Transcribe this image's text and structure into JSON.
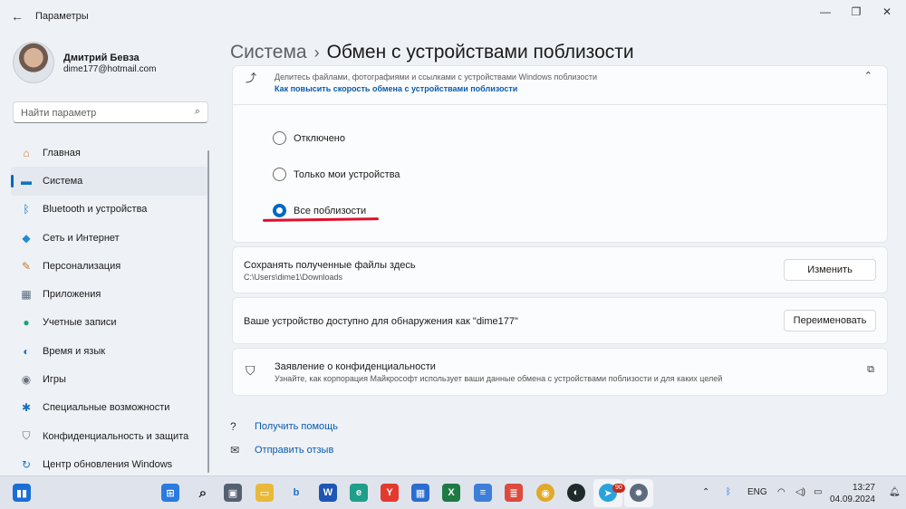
{
  "window": {
    "title": "Параметры",
    "back_icon": "←",
    "minimize": "—",
    "maximize": "❐",
    "close": "✕"
  },
  "profile": {
    "name": "Дмитрий Бевза",
    "email": "dime177@hotmail.com"
  },
  "search": {
    "placeholder": "Найти параметр",
    "icon": "⌕"
  },
  "sidebar": {
    "items": [
      {
        "label": "Главная",
        "icon": "home-icon",
        "glyph": "⌂",
        "color": "#e07a3a"
      },
      {
        "label": "Система",
        "icon": "system-icon",
        "glyph": "▬",
        "color": "#0a74c8"
      },
      {
        "label": "Bluetooth и устройства",
        "icon": "bluetooth-icon",
        "glyph": "ᛒ",
        "color": "#0a74c8"
      },
      {
        "label": "Сеть и Интернет",
        "icon": "wifi-icon",
        "glyph": "◆",
        "color": "#1f8ad6"
      },
      {
        "label": "Персонализация",
        "icon": "brush-icon",
        "glyph": "✎",
        "color": "#c8772c"
      },
      {
        "label": "Приложения",
        "icon": "apps-icon",
        "glyph": "▦",
        "color": "#5a6a80"
      },
      {
        "label": "Учетные записи",
        "icon": "accounts-icon",
        "glyph": "●",
        "color": "#1aa37a"
      },
      {
        "label": "Время и язык",
        "icon": "time-language-icon",
        "glyph": "◐",
        "color": "#1a78c8"
      },
      {
        "label": "Игры",
        "icon": "gaming-icon",
        "glyph": "◉",
        "color": "#6a7280"
      },
      {
        "label": "Специальные возможности",
        "icon": "accessibility-icon",
        "glyph": "✱",
        "color": "#1a6fc0"
      },
      {
        "label": "Конфиденциальность и защита",
        "icon": "privacy-shield-icon",
        "glyph": "⛉",
        "color": "#6c737c"
      },
      {
        "label": "Центр обновления Windows",
        "icon": "update-icon",
        "glyph": "↻",
        "color": "#1a78c8"
      }
    ],
    "active_index": 1
  },
  "breadcrumb": {
    "parent": "Система",
    "separator": "›",
    "current": "Обмен с устройствами поблизости"
  },
  "nearby_sharing": {
    "description": "Делитесь файлами, фотографиями и ссылками с устройствами Windows поблизости",
    "link": "Как повысить скорость обмена с устройствами поблизости",
    "options": [
      {
        "label": "Отключено",
        "checked": false
      },
      {
        "label": "Только мои устройства",
        "checked": false
      },
      {
        "label": "Все поблизости",
        "checked": true
      }
    ]
  },
  "save_location": {
    "title": "Сохранять полученные файлы здесь",
    "path": "C:\\Users\\dime1\\Downloads",
    "button": "Изменить"
  },
  "discoverable": {
    "title": "Ваше устройство доступно для обнаружения как \"dime177\"",
    "button": "Переименовать"
  },
  "privacy": {
    "title": "Заявление о конфиденциальности",
    "subtitle": "Узнайте, как корпорация Майкрософт использует ваши данные обмена с устройствами поблизости и для каких целей"
  },
  "help": {
    "get_help": "Получить помощь",
    "feedback": "Отправить отзыв"
  },
  "taskbar": {
    "language": "ENG",
    "time": "13:27",
    "date": "04.09.2024",
    "telegram_badge": "90"
  }
}
